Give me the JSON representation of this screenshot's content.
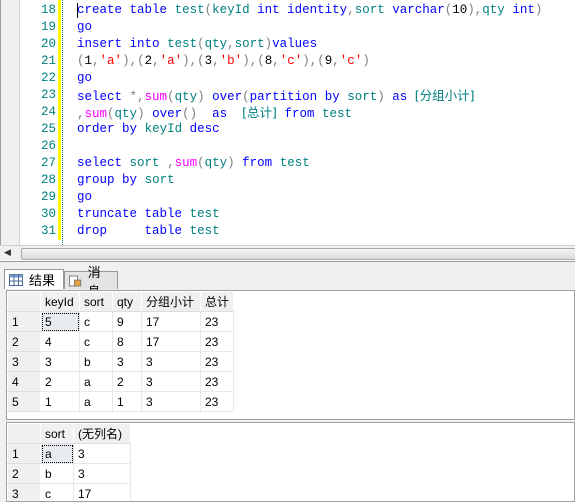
{
  "editor": {
    "lines": [
      {
        "num": "18",
        "tokens": [
          {
            "t": "create",
            "c": "kw"
          },
          {
            "t": " "
          },
          {
            "t": "table",
            "c": "kw"
          },
          {
            "t": " "
          },
          {
            "t": "test",
            "c": "id"
          },
          {
            "t": "(",
            "c": "pu"
          },
          {
            "t": "keyId",
            "c": "id"
          },
          {
            "t": " "
          },
          {
            "t": "int",
            "c": "kw"
          },
          {
            "t": " "
          },
          {
            "t": "identity",
            "c": "kw"
          },
          {
            "t": ",",
            "c": "pu"
          },
          {
            "t": "sort",
            "c": "id"
          },
          {
            "t": " "
          },
          {
            "t": "varchar",
            "c": "kw"
          },
          {
            "t": "(",
            "c": "pu"
          },
          {
            "t": "10",
            "c": "nu"
          },
          {
            "t": "),",
            "c": "pu"
          },
          {
            "t": "qty",
            "c": "id"
          },
          {
            "t": " "
          },
          {
            "t": "int",
            "c": "kw"
          },
          {
            "t": ")",
            "c": "pu"
          }
        ]
      },
      {
        "num": "19",
        "tokens": [
          {
            "t": "go",
            "c": "kw"
          }
        ]
      },
      {
        "num": "20",
        "tokens": [
          {
            "t": "insert",
            "c": "kw"
          },
          {
            "t": " "
          },
          {
            "t": "into",
            "c": "kw"
          },
          {
            "t": " "
          },
          {
            "t": "test",
            "c": "id"
          },
          {
            "t": "(",
            "c": "pu"
          },
          {
            "t": "qty",
            "c": "id"
          },
          {
            "t": ",",
            "c": "pu"
          },
          {
            "t": "sort",
            "c": "id"
          },
          {
            "t": ")",
            "c": "pu"
          },
          {
            "t": "values",
            "c": "kw"
          }
        ]
      },
      {
        "num": "21",
        "tokens": [
          {
            "t": "(",
            "c": "pu"
          },
          {
            "t": "1",
            "c": "nu"
          },
          {
            "t": ",",
            "c": "pu"
          },
          {
            "t": "'a'",
            "c": "st"
          },
          {
            "t": "),(",
            "c": "pu"
          },
          {
            "t": "2",
            "c": "nu"
          },
          {
            "t": ",",
            "c": "pu"
          },
          {
            "t": "'a'",
            "c": "st"
          },
          {
            "t": "),(",
            "c": "pu"
          },
          {
            "t": "3",
            "c": "nu"
          },
          {
            "t": ",",
            "c": "pu"
          },
          {
            "t": "'b'",
            "c": "st"
          },
          {
            "t": "),(",
            "c": "pu"
          },
          {
            "t": "8",
            "c": "nu"
          },
          {
            "t": ",",
            "c": "pu"
          },
          {
            "t": "'c'",
            "c": "st"
          },
          {
            "t": "),(",
            "c": "pu"
          },
          {
            "t": "9",
            "c": "nu"
          },
          {
            "t": ",",
            "c": "pu"
          },
          {
            "t": "'c'",
            "c": "st"
          },
          {
            "t": ")",
            "c": "pu"
          }
        ]
      },
      {
        "num": "22",
        "tokens": [
          {
            "t": "go",
            "c": "kw"
          }
        ]
      },
      {
        "num": "23",
        "tokens": [
          {
            "t": "select",
            "c": "kw"
          },
          {
            "t": " "
          },
          {
            "t": "*,",
            "c": "pu"
          },
          {
            "t": "sum",
            "c": "fn"
          },
          {
            "t": "(",
            "c": "pu"
          },
          {
            "t": "qty",
            "c": "id"
          },
          {
            "t": ")",
            "c": "pu"
          },
          {
            "t": " "
          },
          {
            "t": "over",
            "c": "kw"
          },
          {
            "t": "(",
            "c": "pu"
          },
          {
            "t": "partition",
            "c": "kw"
          },
          {
            "t": " "
          },
          {
            "t": "by",
            "c": "kw"
          },
          {
            "t": " "
          },
          {
            "t": "sort",
            "c": "id"
          },
          {
            "t": ")",
            "c": "pu"
          },
          {
            "t": " "
          },
          {
            "t": "as",
            "c": "kw"
          },
          {
            "t": " "
          },
          {
            "t": "[分组小计]",
            "c": "id cjk"
          }
        ]
      },
      {
        "num": "24",
        "tokens": [
          {
            "t": ",",
            "c": "pu"
          },
          {
            "t": "sum",
            "c": "fn"
          },
          {
            "t": "(",
            "c": "pu"
          },
          {
            "t": "qty",
            "c": "id"
          },
          {
            "t": ")",
            "c": "pu"
          },
          {
            "t": " "
          },
          {
            "t": "over",
            "c": "kw"
          },
          {
            "t": "()",
            "c": "pu"
          },
          {
            "t": "  "
          },
          {
            "t": "as",
            "c": "kw"
          },
          {
            "t": "  "
          },
          {
            "t": "[总计]",
            "c": "id cjk"
          },
          {
            "t": " "
          },
          {
            "t": "from",
            "c": "kw"
          },
          {
            "t": " "
          },
          {
            "t": "test",
            "c": "id"
          }
        ]
      },
      {
        "num": "25",
        "tokens": [
          {
            "t": "order",
            "c": "kw"
          },
          {
            "t": " "
          },
          {
            "t": "by",
            "c": "kw"
          },
          {
            "t": " "
          },
          {
            "t": "keyId",
            "c": "id"
          },
          {
            "t": " "
          },
          {
            "t": "desc",
            "c": "kw"
          }
        ]
      },
      {
        "num": "26",
        "tokens": []
      },
      {
        "num": "27",
        "tokens": [
          {
            "t": "select",
            "c": "kw"
          },
          {
            "t": " "
          },
          {
            "t": "sort",
            "c": "id"
          },
          {
            "t": " "
          },
          {
            "t": ",",
            "c": "pu"
          },
          {
            "t": "sum",
            "c": "fn"
          },
          {
            "t": "(",
            "c": "pu"
          },
          {
            "t": "qty",
            "c": "id"
          },
          {
            "t": ")",
            "c": "pu"
          },
          {
            "t": " "
          },
          {
            "t": "from",
            "c": "kw"
          },
          {
            "t": " "
          },
          {
            "t": "test",
            "c": "id"
          }
        ]
      },
      {
        "num": "28",
        "tokens": [
          {
            "t": "group",
            "c": "kw"
          },
          {
            "t": " "
          },
          {
            "t": "by",
            "c": "kw"
          },
          {
            "t": " "
          },
          {
            "t": "sort",
            "c": "id"
          }
        ]
      },
      {
        "num": "29",
        "tokens": [
          {
            "t": "go",
            "c": "kw"
          }
        ]
      },
      {
        "num": "30",
        "tokens": [
          {
            "t": "truncate",
            "c": "kw"
          },
          {
            "t": " "
          },
          {
            "t": "table",
            "c": "kw"
          },
          {
            "t": " "
          },
          {
            "t": "test",
            "c": "id"
          }
        ]
      },
      {
        "num": "31",
        "tokens": [
          {
            "t": "drop",
            "c": "kw"
          },
          {
            "t": "     "
          },
          {
            "t": "table",
            "c": "kw"
          },
          {
            "t": " "
          },
          {
            "t": "test",
            "c": "id"
          }
        ]
      }
    ]
  },
  "tabs": [
    {
      "label": "结果",
      "icon": "grid-icon"
    },
    {
      "label": "消息",
      "icon": "messages-icon"
    }
  ],
  "grids": [
    {
      "columns": [
        "",
        "keyId",
        "sort",
        "qty",
        "分组小计",
        "总计"
      ],
      "rows": [
        [
          "1",
          "5",
          "c",
          "9",
          "17",
          "23"
        ],
        [
          "2",
          "4",
          "c",
          "8",
          "17",
          "23"
        ],
        [
          "3",
          "3",
          "b",
          "3",
          "3",
          "23"
        ],
        [
          "4",
          "2",
          "a",
          "2",
          "3",
          "23"
        ],
        [
          "5",
          "1",
          "a",
          "1",
          "3",
          "23"
        ]
      ]
    },
    {
      "columns": [
        "",
        "sort",
        "(无列名)"
      ],
      "rows": [
        [
          "1",
          "a",
          "3"
        ],
        [
          "2",
          "b",
          "3"
        ],
        [
          "3",
          "c",
          "17"
        ]
      ]
    }
  ],
  "colors": {
    "keyword": "#0000ff",
    "identifier": "#008080",
    "function": "#ff00ff",
    "string": "#ff0000",
    "punctuation": "#808080"
  }
}
